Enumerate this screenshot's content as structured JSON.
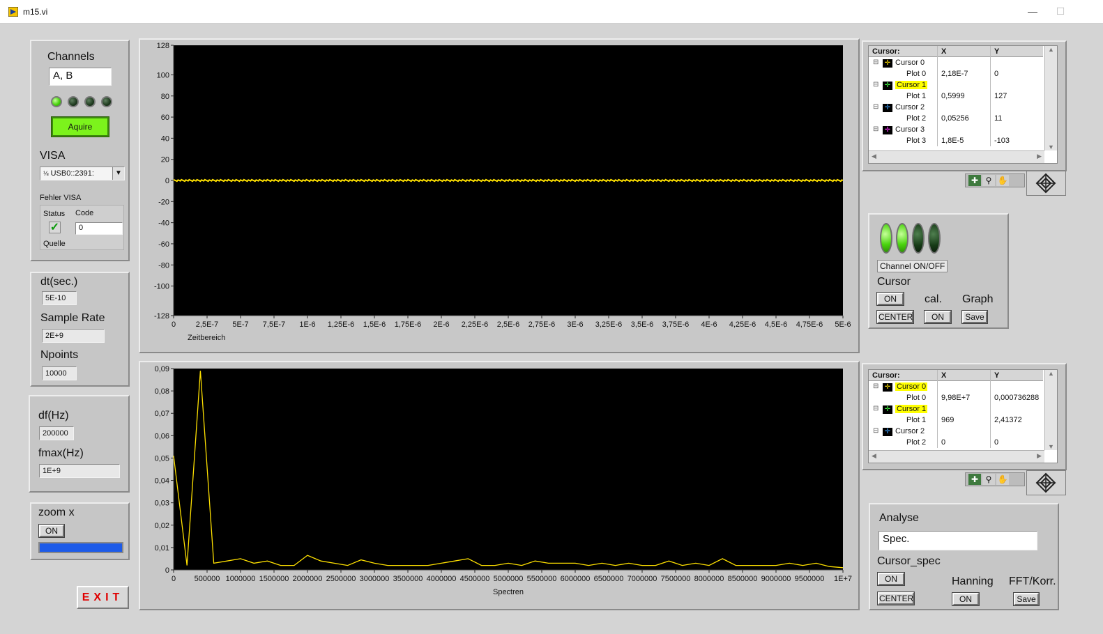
{
  "window": {
    "title": "m15.vi",
    "minimize": "—",
    "maximize": "☐"
  },
  "left": {
    "channels_label": "Channels",
    "channels_value": "A, B",
    "channel_leds": [
      true,
      false,
      false,
      false
    ],
    "acquire_label": "Aquire",
    "visa_label": "VISA",
    "visa_value": "USB0::2391:",
    "fehler_label": "Fehler  VISA",
    "status_label": "Status",
    "code_label": "Code",
    "code_value": "0",
    "quelle_label": "Quelle",
    "dt_label": "dt(sec.)",
    "dt_value": "5E-10",
    "sample_rate_label": "Sample Rate",
    "sample_rate_value": "2E+9",
    "npoints_label": "Npoints",
    "npoints_value": "10000",
    "df_label": "df(Hz)",
    "df_value": "200000",
    "fmax_label": "fmax(Hz)",
    "fmax_value": "1E+9",
    "zoom_label": "zoom x",
    "zoom_btn": "ON",
    "zoom_level": 1.0,
    "exit_label": "EXIT"
  },
  "time_chart": {
    "xlabel": "Zeitbereich",
    "y_ticks": [
      "128",
      "100",
      "80",
      "60",
      "40",
      "20",
      "0",
      "-20",
      "-40",
      "-60",
      "-80",
      "-100",
      "-128"
    ],
    "x_ticks": [
      "0",
      "2,5E-7",
      "5E-7",
      "7,5E-7",
      "1E-6",
      "1,25E-6",
      "1,5E-6",
      "1,75E-6",
      "2E-6",
      "2,25E-6",
      "2,5E-6",
      "2,75E-6",
      "3E-6",
      "3,25E-6",
      "3,5E-6",
      "3,75E-6",
      "4E-6",
      "4,25E-6",
      "4,5E-6",
      "4,75E-6",
      "5E-6"
    ]
  },
  "spectrum_chart": {
    "xlabel": "Spectren",
    "y_ticks": [
      "0,09",
      "0,08",
      "0,07",
      "0,06",
      "0,05",
      "0,04",
      "0,03",
      "0,02",
      "0,01",
      "0"
    ],
    "x_ticks": [
      "0",
      "500000",
      "1000000",
      "1500000",
      "2000000",
      "2500000",
      "3000000",
      "3500000",
      "4000000",
      "4500000",
      "5000000",
      "5500000",
      "6000000",
      "6500000",
      "7000000",
      "7500000",
      "8000000",
      "8500000",
      "9000000",
      "9500000",
      "1E+7"
    ]
  },
  "chart_data": [
    {
      "type": "line",
      "xlabel": "Zeitbereich",
      "ylabel": "",
      "xlim": [
        0,
        5e-06
      ],
      "ylim": [
        -128,
        128
      ],
      "grid": false,
      "series": [
        {
          "color": "#ffe100",
          "x": [
            0,
            5e-06
          ],
          "y": [
            0,
            0
          ]
        }
      ]
    },
    {
      "type": "line",
      "xlabel": "Spectren",
      "ylabel": "",
      "xlim": [
        0,
        10000000
      ],
      "ylim": [
        0,
        0.09
      ],
      "grid": false,
      "series": [
        {
          "color": "#ffe100",
          "x": [
            0,
            200000,
            400000,
            600000,
            800000,
            1000000,
            1200000,
            1400000,
            1600000,
            1800000,
            2000000,
            2200000,
            2400000,
            2600000,
            2800000,
            3000000,
            3200000,
            3400000,
            3600000,
            3800000,
            4000000,
            4200000,
            4400000,
            4600000,
            4800000,
            5000000,
            5200000,
            5400000,
            5600000,
            5800000,
            6000000,
            6200000,
            6400000,
            6600000,
            6800000,
            7000000,
            7200000,
            7400000,
            7600000,
            7800000,
            8000000,
            8200000,
            8400000,
            8600000,
            8800000,
            9000000,
            9200000,
            9400000,
            9600000,
            9800000,
            10000000
          ],
          "y": [
            0.051,
            0.002,
            0.089,
            0.003,
            0.004,
            0.005,
            0.003,
            0.004,
            0.002,
            0.002,
            0.0065,
            0.004,
            0.003,
            0.002,
            0.0045,
            0.003,
            0.002,
            0.002,
            0.002,
            0.002,
            0.003,
            0.004,
            0.005,
            0.002,
            0.002,
            0.003,
            0.002,
            0.004,
            0.003,
            0.003,
            0.003,
            0.002,
            0.003,
            0.002,
            0.003,
            0.002,
            0.002,
            0.004,
            0.002,
            0.003,
            0.002,
            0.005,
            0.002,
            0.002,
            0.002,
            0.002,
            0.003,
            0.002,
            0.003,
            0.0015,
            0.001
          ]
        }
      ]
    }
  ],
  "cursor_table_1": {
    "headers": [
      "Cursor:",
      "X",
      "Y"
    ],
    "rows": [
      {
        "name": "Cursor 0",
        "highlight": false,
        "plot": "Plot 0",
        "x": "2,18E-7",
        "y": "0",
        "color": "#ffe100"
      },
      {
        "name": "Cursor 1",
        "highlight": true,
        "plot": "Plot 1",
        "x": "0,5999",
        "y": "127",
        "color": "#44ff44"
      },
      {
        "name": "Cursor 2",
        "highlight": false,
        "plot": "Plot 2",
        "x": "0,05256",
        "y": "11",
        "color": "#3aa0ff"
      },
      {
        "name": "Cursor 3",
        "highlight": false,
        "plot": "Plot 3",
        "x": "1,8E-5",
        "y": "-103",
        "color": "#ff30ff"
      }
    ]
  },
  "cursor_table_2": {
    "headers": [
      "Cursor:",
      "X",
      "Y"
    ],
    "rows": [
      {
        "name": "Cursor 0",
        "highlight": true,
        "plot": "Plot 0",
        "x": "9,98E+7",
        "y": "0,000736288",
        "color": "#ffe100"
      },
      {
        "name": "Cursor 1",
        "highlight": true,
        "plot": "Plot 1",
        "x": "969",
        "y": "2,41372",
        "color": "#44ff44"
      },
      {
        "name": "Cursor 2",
        "highlight": false,
        "plot": "Plot 2",
        "x": "0",
        "y": "0",
        "color": "#3aa0ff"
      }
    ]
  },
  "ctrl1": {
    "channel_onoff_label": "Channel ON/OFF",
    "leds": [
      true,
      true,
      false,
      false
    ],
    "cursor_label": "Cursor",
    "cursor_on": "ON",
    "center": "CENTER",
    "cal_label": "cal.",
    "cal_on": "ON",
    "graph_label": "Graph",
    "save": "Save"
  },
  "ctrl2": {
    "analyse_label": "Analyse",
    "analyse_value": "Spec.",
    "cursor_spec_label": "Cursor_spec",
    "cursor_spec_on": "ON",
    "center": "CENTER",
    "hanning_label": "Hanning",
    "hanning_on": "ON",
    "fft_label": "FFT/Korr.",
    "save": "Save"
  }
}
